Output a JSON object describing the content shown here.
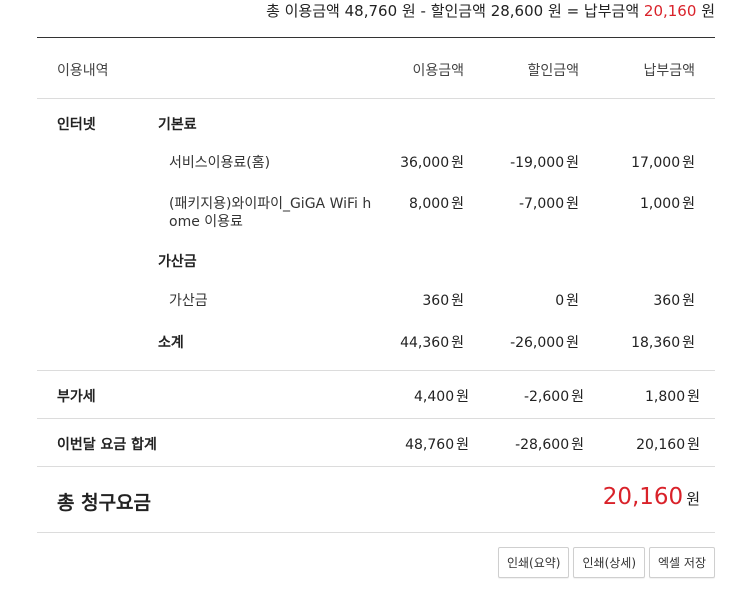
{
  "summary": {
    "use_label": "총 이용금액",
    "use_amount": "48,760",
    "won1": "원",
    "minus": "-",
    "disc_label": "할인금액",
    "disc_amount": "28,600",
    "won2": "원",
    "equals": "=",
    "pay_label": "납부금액",
    "pay_amount": "20,160",
    "won3": "원"
  },
  "header": {
    "item": "이용내역",
    "use": "이용금액",
    "discount": "할인금액",
    "payment": "납부금액"
  },
  "internet": {
    "category": "인터넷",
    "basic_label": "기본료",
    "basic_items": [
      {
        "name": "서비스이용료(홈)",
        "use": "36,000",
        "discount": "-19,000",
        "payment": "17,000"
      },
      {
        "name_line1": "(패키지용)와이파이_GiGA WiFi h",
        "name_line2": "ome 이용료",
        "use": "8,000",
        "discount": "-7,000",
        "payment": "1,000"
      }
    ],
    "extra_label": "가산금",
    "extra_items": [
      {
        "name": "가산금",
        "use": "360",
        "discount": "0",
        "payment": "360"
      }
    ],
    "subtotal": {
      "label": "소계",
      "use": "44,360",
      "discount": "-26,000",
      "payment": "18,360"
    }
  },
  "vat": {
    "label": "부가세",
    "use": "4,400",
    "discount": "-2,600",
    "payment": "1,800"
  },
  "month_total": {
    "label": "이번달 요금 합계",
    "use": "48,760",
    "discount": "-28,600",
    "payment": "20,160"
  },
  "grand_total": {
    "label": "총 청구요금",
    "amount": "20,160"
  },
  "currency": "원",
  "buttons": {
    "print_summary": "인쇄(요약)",
    "print_detail": "인쇄(상세)",
    "excel_save": "엑셀 저장"
  },
  "colors": {
    "accent_red": "#d9222a",
    "divider": "#dcdcdc",
    "top_rule": "#333333"
  }
}
